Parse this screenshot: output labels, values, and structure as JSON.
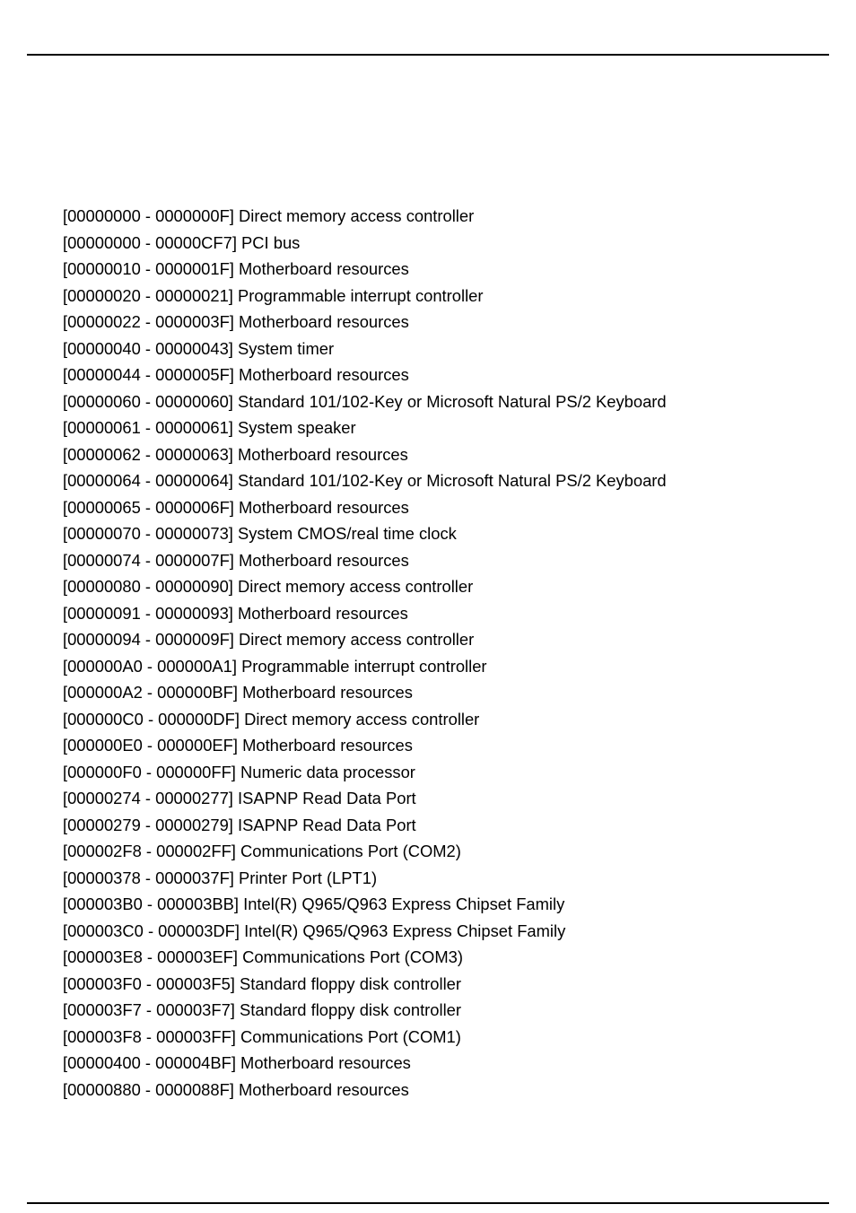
{
  "items": [
    "[00000000 - 0000000F]  Direct memory access controller",
    "[00000000 - 00000CF7]  PCI bus",
    "[00000010 - 0000001F]  Motherboard resources",
    "[00000020 - 00000021]  Programmable interrupt controller",
    "[00000022 - 0000003F]  Motherboard resources",
    "[00000040 - 00000043]  System timer",
    "[00000044 - 0000005F]  Motherboard resources",
    "[00000060 - 00000060]  Standard 101/102-Key or Microsoft Natural PS/2 Keyboard",
    "[00000061 - 00000061]  System speaker",
    "[00000062 - 00000063]  Motherboard resources",
    "[00000064 - 00000064]  Standard 101/102-Key or Microsoft Natural PS/2 Keyboard",
    "[00000065 - 0000006F]  Motherboard resources",
    "[00000070 - 00000073]  System CMOS/real time clock",
    "[00000074 - 0000007F]  Motherboard resources",
    "[00000080 - 00000090]  Direct memory access controller",
    "[00000091 - 00000093]  Motherboard resources",
    "[00000094 - 0000009F]  Direct memory access controller",
    "[000000A0 - 000000A1]  Programmable interrupt controller",
    "[000000A2 - 000000BF]  Motherboard resources",
    "[000000C0 - 000000DF]  Direct memory access controller",
    "[000000E0 - 000000EF]  Motherboard resources",
    "[000000F0 - 000000FF]  Numeric data processor",
    "[00000274 - 00000277]  ISAPNP Read Data Port",
    "[00000279 - 00000279]  ISAPNP Read Data Port",
    "[000002F8 - 000002FF]  Communications Port (COM2)",
    "[00000378 - 0000037F]  Printer Port (LPT1)",
    "[000003B0 - 000003BB]  Intel(R)  Q965/Q963 Express Chipset Family",
    "[000003C0 - 000003DF]  Intel(R)  Q965/Q963 Express Chipset Family",
    "[000003E8 - 000003EF]  Communications Port (COM3)",
    "[000003F0 - 000003F5]  Standard floppy disk controller",
    "[000003F7 - 000003F7]  Standard floppy disk controller",
    "[000003F8 - 000003FF]  Communications Port (COM1)",
    "[00000400 - 000004BF]  Motherboard resources",
    "[00000880 - 0000088F]  Motherboard resources"
  ]
}
